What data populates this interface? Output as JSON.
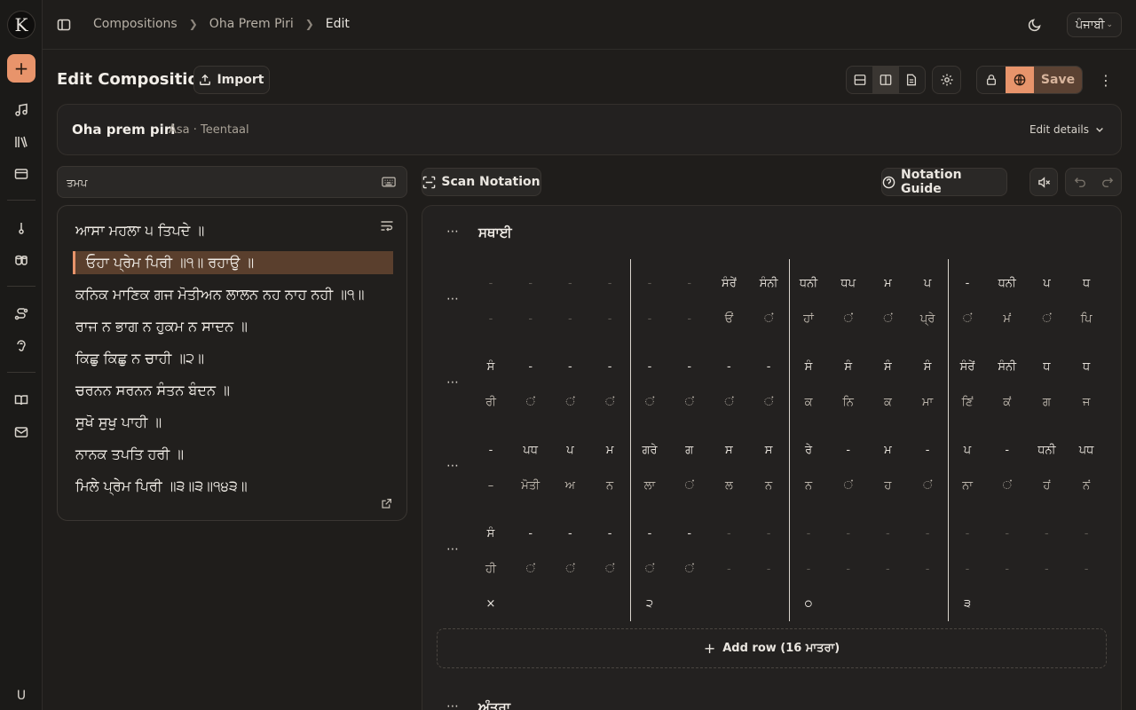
{
  "sidebar": {
    "logo": "K",
    "add": "+",
    "user_initial": "U"
  },
  "header": {
    "breadcrumbs": [
      "Compositions",
      "Oha Prem Piri",
      "Edit"
    ],
    "language": "ਪੰਜਾਬੀ"
  },
  "title": {
    "heading": "Edit Composition",
    "import_label": "Import",
    "save_label": "Save"
  },
  "composition": {
    "name": "Oha prem piri",
    "meta": "Asa · Teentaal",
    "edit_details_label": "Edit details"
  },
  "search": {
    "value": "ਤਮਪ",
    "placeholder": ""
  },
  "lyrics": [
    "ਆਸਾ ਮਹਲਾ ੫ ਤਿਪਦੇ ॥",
    "ਓਹਾ ਪ੍ਰੇਮ ਪਿਰੀ ॥੧॥ ਰਹਾਉ ॥",
    "ਕਨਿਕ ਮਾਣਿਕ ਗਜ ਮੋਤੀਅਨ ਲਾਲਨ ਨਹ ਨਾਹ ਨਹੀ ॥੧॥",
    "ਰਾਜ ਨ ਭਾਗ ਨ ਹੁਕਮ ਨ ਸਾਦਨ ॥",
    "ਕਿਛੁ ਕਿਛੁ ਨ ਚਾਹੀ ॥੨॥",
    "ਚਰਨਨ ਸਰਨਨ ਸੰਤਨ ਬੰਦਨ ॥",
    "ਸੁਖੋ ਸੁਖੁ ਪਾਹੀ ॥",
    "ਨਾਨਕ ਤਪਤਿ ਹਰੀ ॥",
    "ਮਿਲੇ ਪ੍ਰੇਮ ਪਿਰੀ ॥੩॥੩॥੧੪੩॥"
  ],
  "notation_toolbar": {
    "scan_label": "Scan Notation",
    "guide_label": "Notation Guide"
  },
  "sections": {
    "sthayi": "ਸਥਾਈ",
    "antara": "ਅੰਤਰਾ"
  },
  "rows": [
    {
      "swar": [
        "-",
        "-",
        "-",
        "-",
        "-",
        "-",
        "ਸੰਰੇਂ",
        "ਸੰਨੀ",
        "ਧਨੀ",
        "ਧਪ",
        "ਮ",
        "ਪ",
        "-",
        "ਧਨੀ",
        "ਪ",
        "ਧ"
      ],
      "lyrics": [
        "-",
        "-",
        "-",
        "-",
        "-",
        "-",
        "ਓਂਂ",
        "ਂਂ",
        "ਹਾਂ",
        "ਂਂ",
        "ਂ",
        "ਪ੍ਰੇ",
        "ਂ",
        "ਮਂ",
        "ਂ",
        "ਪਿ"
      ]
    },
    {
      "swar": [
        "ਸੰ",
        "-",
        "-",
        "-",
        "-",
        "-",
        "-",
        "-",
        "ਸੰ",
        "ਸੰ",
        "ਸੰ",
        "ਸੰ",
        "ਸੰਰੇਂ",
        "ਸੰਨੀ",
        "ਧ",
        "ਧ"
      ],
      "lyrics": [
        "ਰੀ",
        "ਂ",
        "ਂ",
        "ਂ",
        "ਂ",
        "ਂ",
        "ਂ",
        "ਂ",
        "ਕ",
        "ਨਿ",
        "ਕ",
        "ਮਾ",
        "ਣਿਂ",
        "ਕਂ",
        "ਗ",
        "ਜ"
      ]
    },
    {
      "swar": [
        "-",
        "ਪਧ",
        "ਪ",
        "ਮ",
        "ਗਰੇ",
        "ਗ",
        "ਸ",
        "ਸ",
        "ਰੇ",
        "-",
        "ਮ",
        "-",
        "ਪ",
        "-",
        "ਧਨੀ",
        "ਪਧ"
      ],
      "lyrics": [
        "–",
        "ਮੋਤੀ",
        "ਅ",
        "ਨ",
        "ਲਾ",
        "ਂ",
        "ਲ",
        "ਨ",
        "ਨ",
        "ਂ",
        "ਹ",
        "ਂ",
        "ਨਾ",
        "ਂ",
        "ਹਂ",
        "ਨਂ"
      ]
    },
    {
      "swar": [
        "ਸੰ",
        "-",
        "-",
        "-",
        "-",
        "-",
        "-",
        "-",
        "-",
        "-",
        "-",
        "-",
        "-",
        "-",
        "-",
        "-"
      ],
      "lyrics": [
        "ਹੀ",
        "ਂ",
        "ਂ",
        "ਂ",
        "ਂ",
        "ਂ",
        "-",
        "-",
        "-",
        "-",
        "-",
        "-",
        "-",
        "-",
        "-",
        "-"
      ]
    }
  ],
  "tala_marks": [
    "×",
    "੨",
    "੦",
    "੩"
  ],
  "add_row_label": "Add row (16 ਮਾਤਰਾ)",
  "colors": {
    "accent": "#e8946b",
    "background": "#1f1d1b"
  }
}
